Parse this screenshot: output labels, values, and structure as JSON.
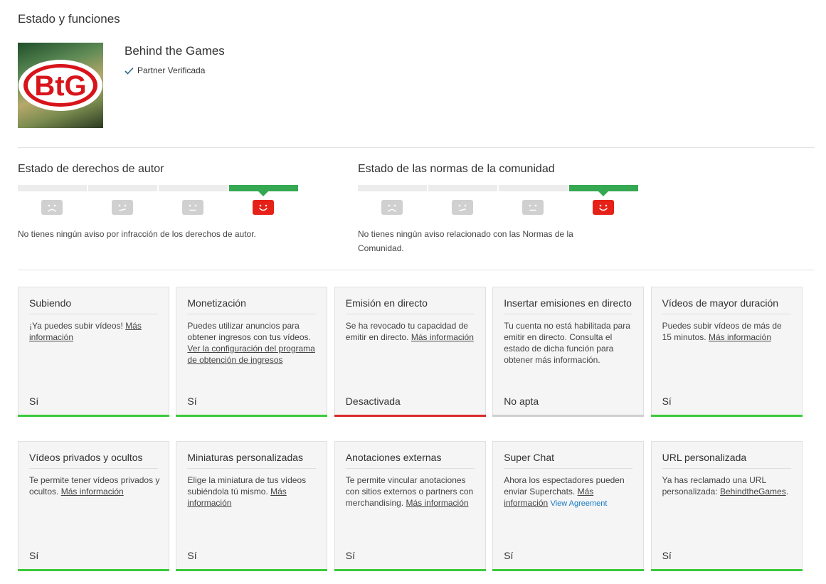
{
  "page": {
    "title": "Estado y funciones"
  },
  "channel": {
    "name": "Behind the Games",
    "verified_label": "Partner Verificada",
    "logo_text": "BtG"
  },
  "copyright": {
    "title": "Estado de derechos de autor",
    "active_level": 4,
    "description": "No tienes ningún aviso por infracción de los derechos de autor."
  },
  "community": {
    "title": "Estado de las normas de la comunidad",
    "active_level": 4,
    "description": "No tienes ningún aviso relacionado con las Normas de la Comunidad."
  },
  "colors": {
    "active_green": "#35a852",
    "status_green": "#3bc93b",
    "status_red": "#d9282a",
    "status_gray": "#cfcfcf",
    "face_active": "#e62117",
    "face_inactive": "#d0d0d0",
    "link_blue": "#167ac6"
  },
  "cards": [
    {
      "title": "Subiendo",
      "text": "¡Ya puedes subir vídeos!",
      "link": "Más información",
      "status": "Sí",
      "state": "green"
    },
    {
      "title": "Monetización",
      "text": "Puedes utilizar anuncios para obtener ingresos con tus vídeos.",
      "link": "Ver la configuración del programa de obtención de ingresos",
      "status": "Sí",
      "state": "green"
    },
    {
      "title": "Emisión en directo",
      "text": "Se ha revocado tu capacidad de emitir en directo.",
      "link": "Más información",
      "status": "Desactivada",
      "state": "red"
    },
    {
      "title": "Insertar emisiones en directo",
      "text": "Tu cuenta no está habilitada para emitir en directo. Consulta el estado de dicha función para obtener más información.",
      "status": "No apta",
      "state": "gray"
    },
    {
      "title": "Vídeos de mayor duración",
      "text": "Puedes subir vídeos de más de 15 minutos.",
      "link": "Más información",
      "status": "Sí",
      "state": "green"
    },
    {
      "title": "Vídeos privados y ocultos",
      "text": "Te permite tener vídeos privados y ocultos.",
      "link": "Más información",
      "status": "Sí",
      "state": "green"
    },
    {
      "title": "Miniaturas personalizadas",
      "text": "Elige la miniatura de tus vídeos subiéndola tú mismo.",
      "link": "Más información",
      "status": "Sí",
      "state": "green"
    },
    {
      "title": "Anotaciones externas",
      "text": "Te permite vincular anotaciones con sitios externos o partners con merchandising.",
      "link": "Más información",
      "status": "Sí",
      "state": "green"
    },
    {
      "title": "Super Chat",
      "text": "Ahora los espectadores pueden enviar Superchats.",
      "link": "Más información",
      "extra_link": "View Agreement",
      "status": "Sí",
      "state": "green"
    },
    {
      "title": "URL personalizada",
      "text": "Ya has reclamado una URL personalizada:",
      "link": "BehindtheGames",
      "suffix": ".",
      "status": "Sí",
      "state": "green"
    }
  ]
}
